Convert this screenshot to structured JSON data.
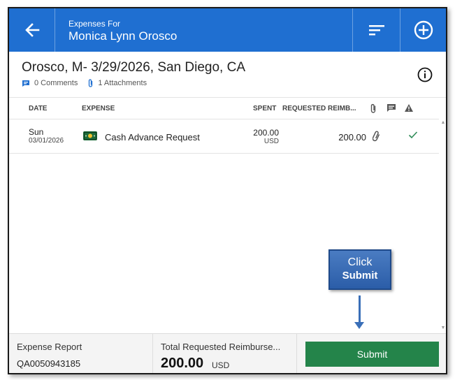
{
  "header": {
    "subtitle": "Expenses For",
    "name": "Monica Lynn Orosco"
  },
  "report": {
    "title": "Orosco, M- 3/29/2026, San Diego, CA",
    "comments": "0 Comments",
    "attachments": "1 Attachments"
  },
  "table": {
    "columns": [
      "DATE",
      "EXPENSE",
      "SPENT",
      "REQUESTED REIMB..."
    ],
    "rows": [
      {
        "day": "Sun",
        "date": "03/01/2026",
        "expense": "Cash Advance Request",
        "spent": "200.00",
        "spent_currency": "USD",
        "reimbursement": "200.00"
      }
    ]
  },
  "footer": {
    "report_label": "Expense Report",
    "report_id": "QA0050943185",
    "total_label": "Total Requested Reimburse...",
    "total_amount": "200.00",
    "total_currency": "USD",
    "submit_label": "Submit"
  },
  "callout": {
    "line1": "Click",
    "line2": "Submit"
  },
  "colors": {
    "header_bg": "#1f6fd1",
    "submit_bg": "#24844a",
    "callout_bg": "#2b5da8"
  }
}
